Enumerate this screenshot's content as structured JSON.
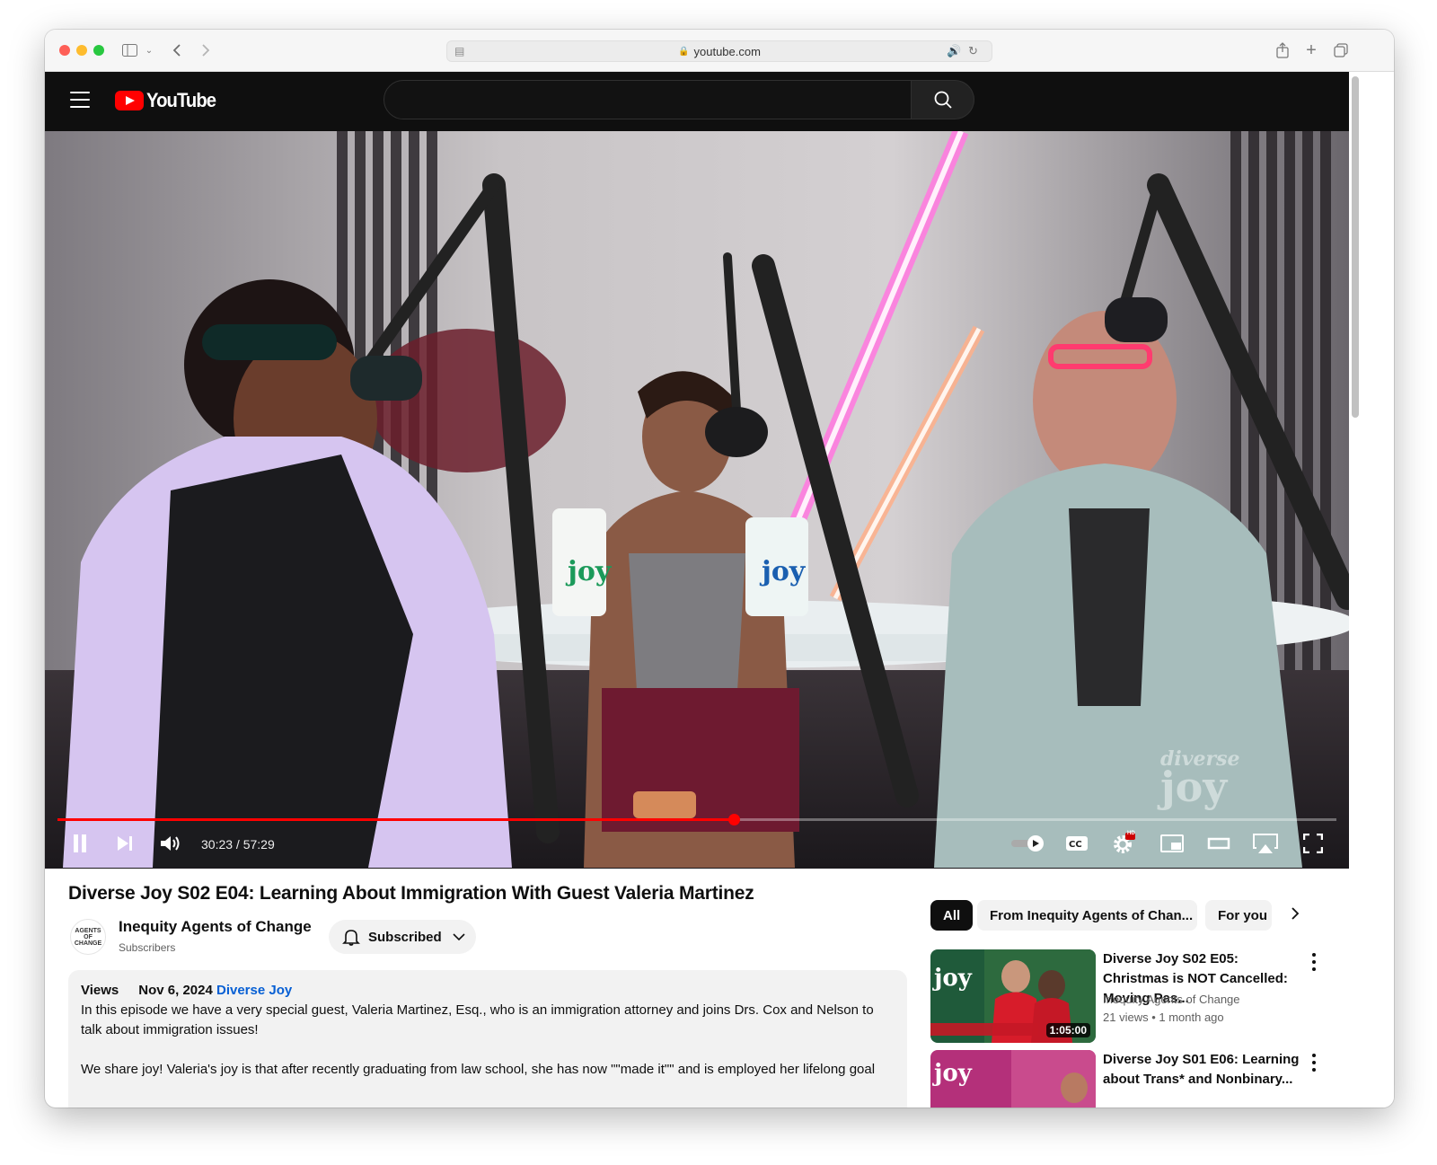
{
  "browser": {
    "url": "youtube.com"
  },
  "youtube": {
    "logo_text": "YouTube",
    "search_placeholder": ""
  },
  "player": {
    "current_time": "30:23",
    "duration": "57:29",
    "time_display": "30:23 / 57:29",
    "progress_fraction": 0.529,
    "settings_badge": "HD",
    "watermark_top": "diverse",
    "watermark_bottom": "joy"
  },
  "video": {
    "title": "Diverse Joy S02 E04: Learning About Immigration With Guest Valeria Martinez",
    "channel": {
      "name": "Inequity Agents of Change",
      "subscribers": "Subscribers",
      "avatar_text": "AGENTS OF CHANGE"
    },
    "subscribe_label": "Subscribed",
    "description": {
      "views": "Views",
      "date": "Nov 6, 2024",
      "tag": "Diverse Joy",
      "paragraph1": "In this episode we have a very special guest, Valeria Martinez, Esq., who is an immigration attorney and joins Drs. Cox and Nelson to talk about immigration issues!",
      "paragraph2": "We share joy! Valeria's joy is that after recently graduating from law school, she has now \"\"made it\"\" and is employed her lifelong goal"
    }
  },
  "chips": [
    "All",
    "From Inequity Agents of Chan...",
    "For you"
  ],
  "recommendations": [
    {
      "title": "Diverse Joy S02 E05: Christmas is NOT Cancelled: Moving Pas...",
      "channel": "Inequity Agents of Change",
      "views": "21 views",
      "age": "1 month ago",
      "duration": "1:05:00",
      "thumb_text": "joy"
    },
    {
      "title": "Diverse Joy S01 E06: Learning about Trans* and Nonbinary...",
      "channel": "",
      "views": "",
      "age": "",
      "duration": "",
      "thumb_text": "joy"
    }
  ],
  "colors": {
    "accent_red": "#ff0000",
    "link_blue": "#065fd4",
    "masthead": "#0f0f0f"
  }
}
